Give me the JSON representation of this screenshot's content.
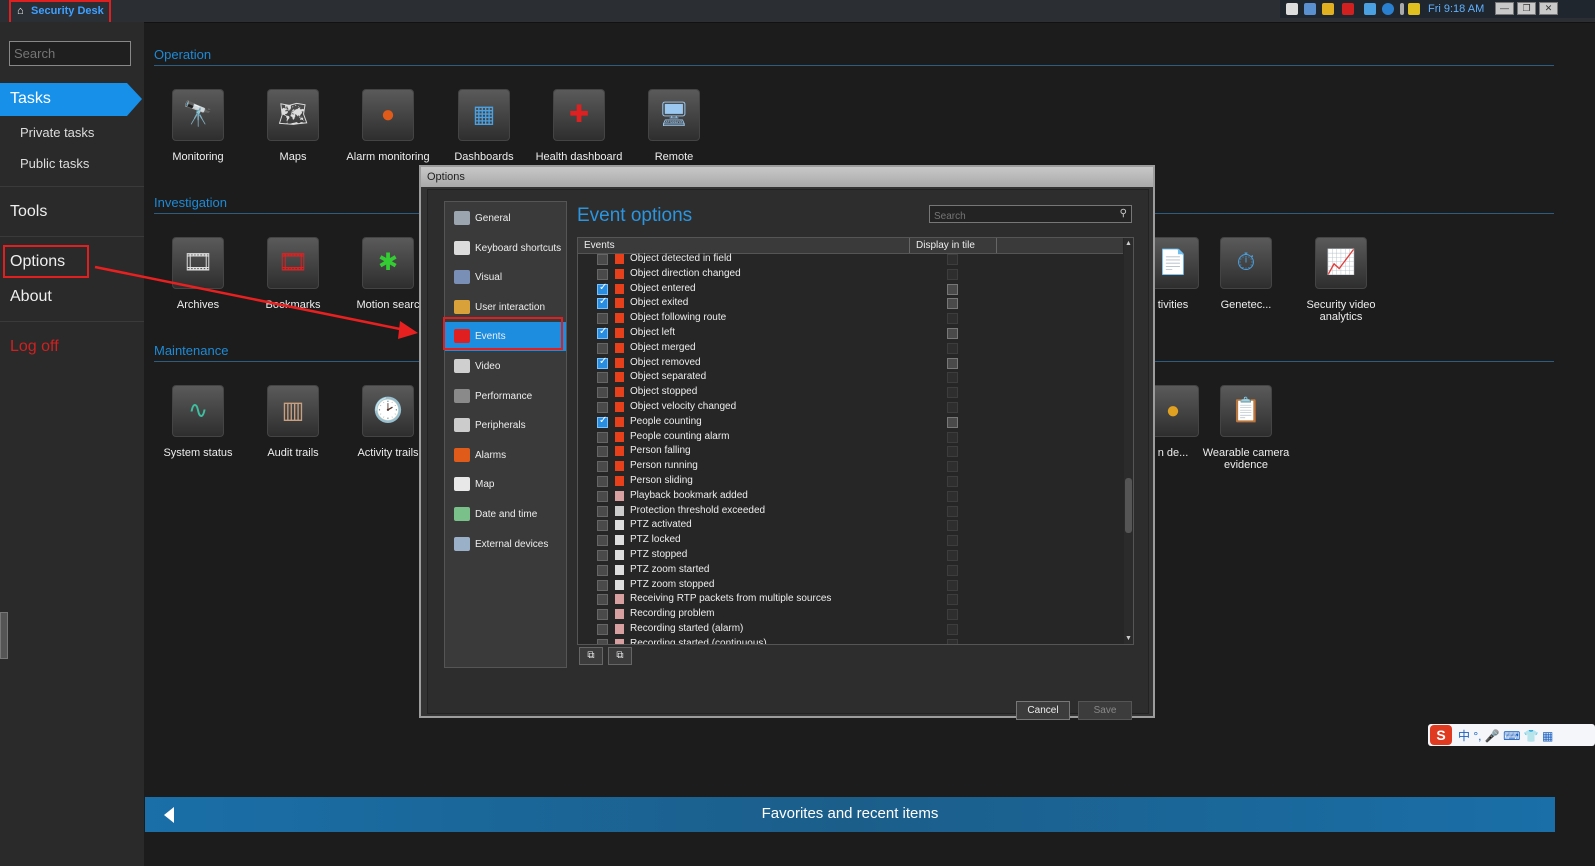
{
  "window": {
    "app_title": "Security Desk",
    "clock": "Fri 9:18 AM",
    "window_buttons": [
      "minimize",
      "restore",
      "close"
    ]
  },
  "sidebar": {
    "search_placeholder": "Search",
    "tasks": "Tasks",
    "private_tasks": "Private tasks",
    "public_tasks": "Public tasks",
    "tools": "Tools",
    "options": "Options",
    "about": "About",
    "logoff": "Log off"
  },
  "sections": {
    "operation": "Operation",
    "investigation": "Investigation",
    "maintenance": "Maintenance"
  },
  "operation_tasks": [
    "Monitoring",
    "Maps",
    "Alarm monitoring",
    "Dashboards",
    "Health dashboard",
    "Remote"
  ],
  "investigation_tasks": [
    "Archives",
    "Bookmarks",
    "Motion search",
    "Activities",
    "Genetec...",
    "Security video analytics"
  ],
  "maintenance_tasks": [
    "System status",
    "Audit trails",
    "Activity trails",
    "...n de...",
    "Wearable camera evidence"
  ],
  "visible_labels": {
    "motion_search_cut": "Motion searc",
    "activities_cut": "tivities",
    "n_de_cut": "n de...",
    "health_dashboard_cut": "Health dashboard"
  },
  "favorites": {
    "label": "Favorites and recent items"
  },
  "dialog": {
    "title": "Options",
    "heading": "Event options",
    "search_placeholder": "Search",
    "nav": [
      {
        "label": "General",
        "color": "#9aa5b0"
      },
      {
        "label": "Keyboard shortcuts",
        "color": "#dcdcdc"
      },
      {
        "label": "Visual",
        "color": "#7a8fb5"
      },
      {
        "label": "User interaction",
        "color": "#d9a13a"
      },
      {
        "label": "Events",
        "color": "#e02020"
      },
      {
        "label": "Video",
        "color": "#cfcfcf"
      },
      {
        "label": "Performance",
        "color": "#8a8a8a"
      },
      {
        "label": "Peripherals",
        "color": "#cccccc"
      },
      {
        "label": "Alarms",
        "color": "#e05a1a"
      },
      {
        "label": "Map",
        "color": "#e8e8e8"
      },
      {
        "label": "Date and time",
        "color": "#7ac08a"
      },
      {
        "label": "External devices",
        "color": "#9ab0c8"
      }
    ],
    "active_nav": "Events",
    "columns": {
      "events": "Events",
      "display_in_tile": "Display in tile"
    },
    "rows": [
      {
        "name": "Object detected in field",
        "checked": false,
        "tile": false,
        "icon": "red-flag"
      },
      {
        "name": "Object direction changed",
        "checked": false,
        "tile": false,
        "icon": "red-flag"
      },
      {
        "name": "Object entered",
        "checked": true,
        "tile": true,
        "icon": "red-flag"
      },
      {
        "name": "Object exited",
        "checked": true,
        "tile": true,
        "icon": "red-flag"
      },
      {
        "name": "Object following route",
        "checked": false,
        "tile": false,
        "icon": "red-flag"
      },
      {
        "name": "Object left",
        "checked": true,
        "tile": true,
        "icon": "red-flag"
      },
      {
        "name": "Object merged",
        "checked": false,
        "tile": false,
        "icon": "red-flag"
      },
      {
        "name": "Object removed",
        "checked": true,
        "tile": true,
        "icon": "red-flag"
      },
      {
        "name": "Object separated",
        "checked": false,
        "tile": false,
        "icon": "red-flag"
      },
      {
        "name": "Object stopped",
        "checked": false,
        "tile": false,
        "icon": "red-flag"
      },
      {
        "name": "Object velocity changed",
        "checked": false,
        "tile": false,
        "icon": "red-flag"
      },
      {
        "name": "People counting",
        "checked": true,
        "tile": true,
        "icon": "red-flag"
      },
      {
        "name": "People counting alarm",
        "checked": false,
        "tile": false,
        "icon": "red-flag"
      },
      {
        "name": "Person falling",
        "checked": false,
        "tile": false,
        "icon": "red-flag"
      },
      {
        "name": "Person running",
        "checked": false,
        "tile": false,
        "icon": "red-flag"
      },
      {
        "name": "Person sliding",
        "checked": false,
        "tile": false,
        "icon": "red-flag"
      },
      {
        "name": "Playback bookmark added",
        "checked": false,
        "tile": false,
        "icon": "bookmark"
      },
      {
        "name": "Protection threshold exceeded",
        "checked": false,
        "tile": false,
        "icon": "server"
      },
      {
        "name": "PTZ activated",
        "checked": false,
        "tile": false,
        "icon": "ptz"
      },
      {
        "name": "PTZ locked",
        "checked": false,
        "tile": false,
        "icon": "ptz"
      },
      {
        "name": "PTZ stopped",
        "checked": false,
        "tile": false,
        "icon": "ptz"
      },
      {
        "name": "PTZ zoom started",
        "checked": false,
        "tile": false,
        "icon": "ptz"
      },
      {
        "name": "PTZ zoom stopped",
        "checked": false,
        "tile": false,
        "icon": "ptz"
      },
      {
        "name": "Receiving RTP packets from multiple sources",
        "checked": false,
        "tile": false,
        "icon": "bookmark"
      },
      {
        "name": "Recording problem",
        "checked": false,
        "tile": false,
        "icon": "bookmark"
      },
      {
        "name": "Recording started (alarm)",
        "checked": false,
        "tile": false,
        "icon": "bookmark"
      },
      {
        "name": "Recording started (continuous)",
        "checked": false,
        "tile": false,
        "icon": "bookmark"
      }
    ],
    "cancel": "Cancel",
    "save": "Save"
  },
  "ime": {
    "logo": "S",
    "text": "中 °, 🎤 ⌨ 👕 ▦"
  }
}
